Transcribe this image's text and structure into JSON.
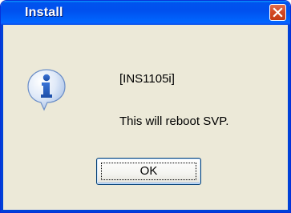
{
  "window": {
    "title": "Install",
    "close_icon": "close-icon"
  },
  "dialog": {
    "icon": "info-icon",
    "code": "[INS1105i]",
    "message": "This will reboot SVP."
  },
  "buttons": {
    "ok_label": "OK"
  },
  "colors": {
    "titlebar": "#0054e3",
    "close_button": "#d44a25",
    "dialog_background": "#ece9d8",
    "info_icon": "#2a5fbf"
  }
}
